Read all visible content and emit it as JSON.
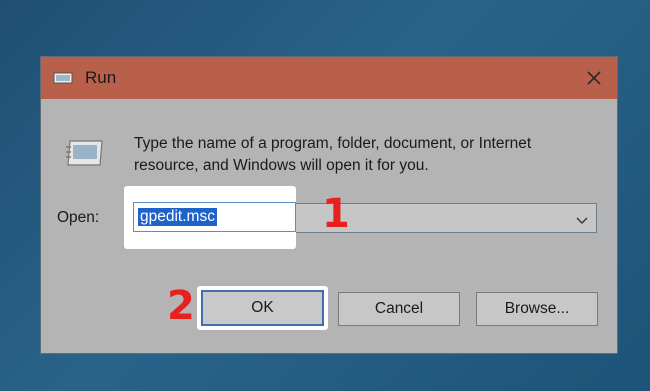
{
  "window": {
    "title": "Run",
    "description": "Type the name of a program, folder, document, or Internet resource, and Windows will open it for you.",
    "open_label": "Open:",
    "input_value": "gpedit.msc",
    "buttons": {
      "ok": "OK",
      "cancel": "Cancel",
      "browse": "Browse..."
    }
  },
  "annotations": {
    "step1": "1",
    "step2": "2"
  },
  "colors": {
    "titlebar": "#b8604a",
    "dialog_bg": "#b4b4b4",
    "selection": "#1e63c8",
    "annotation": "#e8201f",
    "desktop": "#2a6389"
  },
  "icons": {
    "title": "run-app-icon",
    "close": "close-icon",
    "run": "run-program-icon",
    "dropdown": "chevron-down-icon"
  }
}
